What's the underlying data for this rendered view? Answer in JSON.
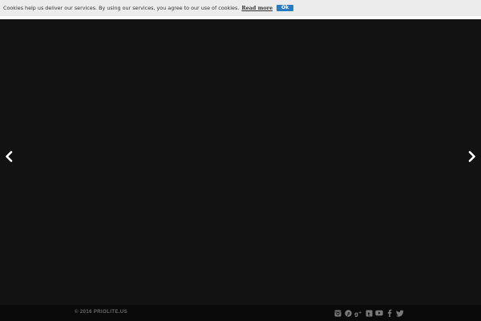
{
  "cookie_bar": {
    "message": "Cookies help us deliver our services. By using our services, you agree to our use of cookies.",
    "read_more": "Read more",
    "ok": "Ok"
  },
  "slider": {
    "prev_icon": "chevron-left-icon",
    "next_icon": "chevron-right-icon"
  },
  "footer": {
    "copyright": "© 2016 PRIOLITE.US",
    "social_icons": [
      "instagram-icon",
      "pinterest-icon",
      "google-plus-icon",
      "tumblr-icon",
      "youtube-icon",
      "facebook-icon",
      "twitter-icon"
    ]
  },
  "colors": {
    "background": "#121212",
    "cookie_bar": "#ececec",
    "ok_button": "#2b7bc0",
    "footer": "#0a0a0a",
    "icon": "#7a7a7a"
  }
}
